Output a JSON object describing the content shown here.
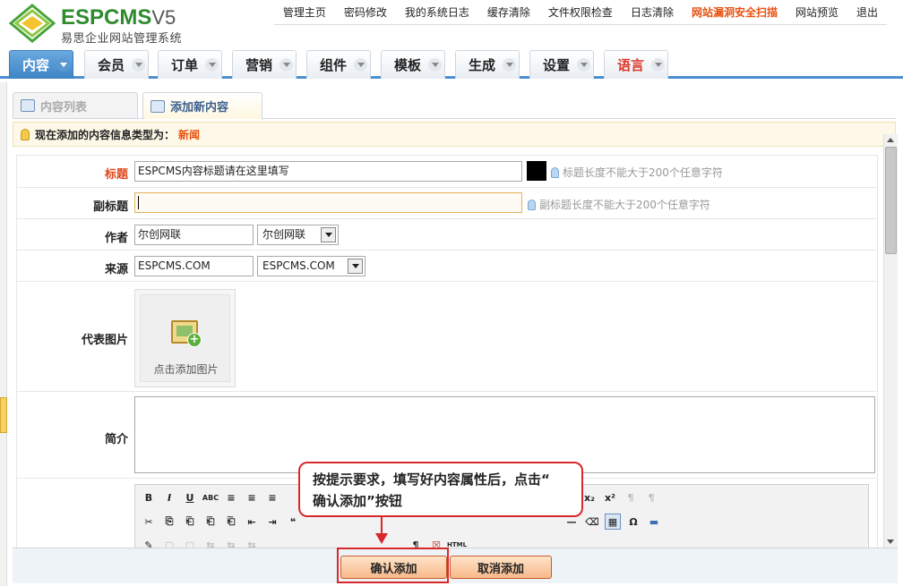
{
  "header": {
    "logo_text_esp": "ESP",
    "logo_text_cms": "CMS",
    "logo_text_v5": "V5",
    "logo_subtitle": "易思企业网站管理系统",
    "top_links": [
      {
        "label": "管理主页",
        "hot": false
      },
      {
        "label": "密码修改",
        "hot": false
      },
      {
        "label": "我的系统日志",
        "hot": false
      },
      {
        "label": "缓存清除",
        "hot": false
      },
      {
        "label": "文件权限检查",
        "hot": false
      },
      {
        "label": "日志清除",
        "hot": false
      },
      {
        "label": "网站漏洞安全扫描",
        "hot": true
      },
      {
        "label": "网站预览",
        "hot": false
      },
      {
        "label": "退出",
        "hot": false
      }
    ]
  },
  "main_nav": {
    "tabs": [
      {
        "label": "内容",
        "active": true
      },
      {
        "label": "会员",
        "active": false
      },
      {
        "label": "订单",
        "active": false
      },
      {
        "label": "营销",
        "active": false
      },
      {
        "label": "组件",
        "active": false
      },
      {
        "label": "模板",
        "active": false
      },
      {
        "label": "生成",
        "active": false
      },
      {
        "label": "设置",
        "active": false
      },
      {
        "label": "语言",
        "active": false
      }
    ]
  },
  "sub_tabs": {
    "list_label": "内容列表",
    "add_label": "添加新内容"
  },
  "notice": {
    "prefix": "现在添加的内容信息类型为：",
    "value": "新闻"
  },
  "form": {
    "title_label": "标题",
    "title_value": "ESPCMS内容标题请在这里填写",
    "title_hint": "标题长度不能大于200个任意字符",
    "subtitle_label": "副标题",
    "subtitle_value": "",
    "subtitle_hint": "副标题长度不能大于200个任意字符",
    "author_label": "作者",
    "author_value": "尔创网联",
    "author_select": "尔创网联",
    "source_label": "来源",
    "source_value": "ESPCMS.COM",
    "source_select": "ESPCMS.COM",
    "image_label": "代表图片",
    "image_add_label": "点击添加图片",
    "summary_label": "简介",
    "summary_value": ""
  },
  "editor_toolbar": {
    "row1": [
      "B",
      "I",
      "U",
      "ABC",
      "≡",
      "≡",
      "≡"
    ],
    "row1_right": [
      "x₂",
      "x²",
      "¶",
      "¶"
    ],
    "row2": [
      "✂",
      "⎘",
      "⎗",
      "⎗",
      "⎗",
      "⇤",
      "⇥",
      "❝"
    ],
    "row2_right": [
      "—",
      "⌫",
      "▦",
      "Ω",
      "▬"
    ],
    "row3": [
      "✎",
      "□",
      "□",
      "⇆",
      "⇆",
      "⇆",
      "¶",
      "☒",
      "HTML"
    ]
  },
  "callout": {
    "line1": "按提示要求，填写好内容属性后，点击“",
    "line2": "确认添加”按钮"
  },
  "buttons": {
    "confirm": "确认添加",
    "cancel": "取消添加"
  },
  "colors": {
    "accent_blue": "#4a90d0",
    "hot_orange": "#e8500e",
    "callout_red": "#d9282b",
    "brand_green": "#2e8b2e"
  }
}
